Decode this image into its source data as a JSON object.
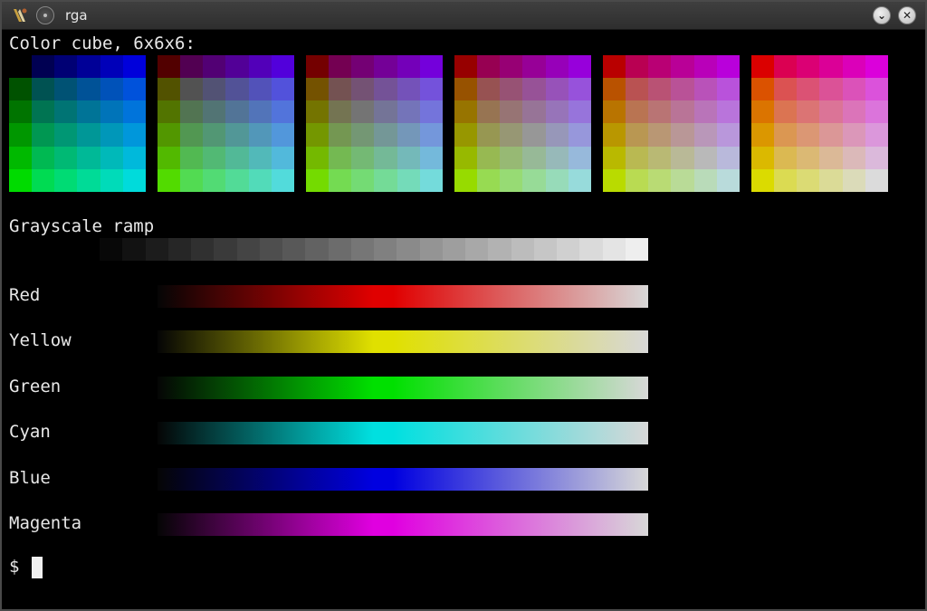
{
  "window": {
    "title": "rga"
  },
  "terminal": {
    "cube_heading": "Color cube, 6x6x6:",
    "gray_heading": "Grayscale ramp",
    "ramps": [
      {
        "label": "Red",
        "color": "#e00000"
      },
      {
        "label": "Yellow",
        "color": "#e0e000"
      },
      {
        "label": "Green",
        "color": "#00e000"
      },
      {
        "label": "Cyan",
        "color": "#00e0e0"
      },
      {
        "label": "Blue",
        "color": "#0000e0"
      },
      {
        "label": "Magenta",
        "color": "#e000e0"
      }
    ],
    "prompt": "$"
  },
  "icons": {
    "app": "terminal-app-icon",
    "menu": "window-menu-icon",
    "minimize": "chevron-down-icon",
    "close": "close-icon"
  },
  "minimize_glyph": "⌄",
  "close_glyph": "✕"
}
